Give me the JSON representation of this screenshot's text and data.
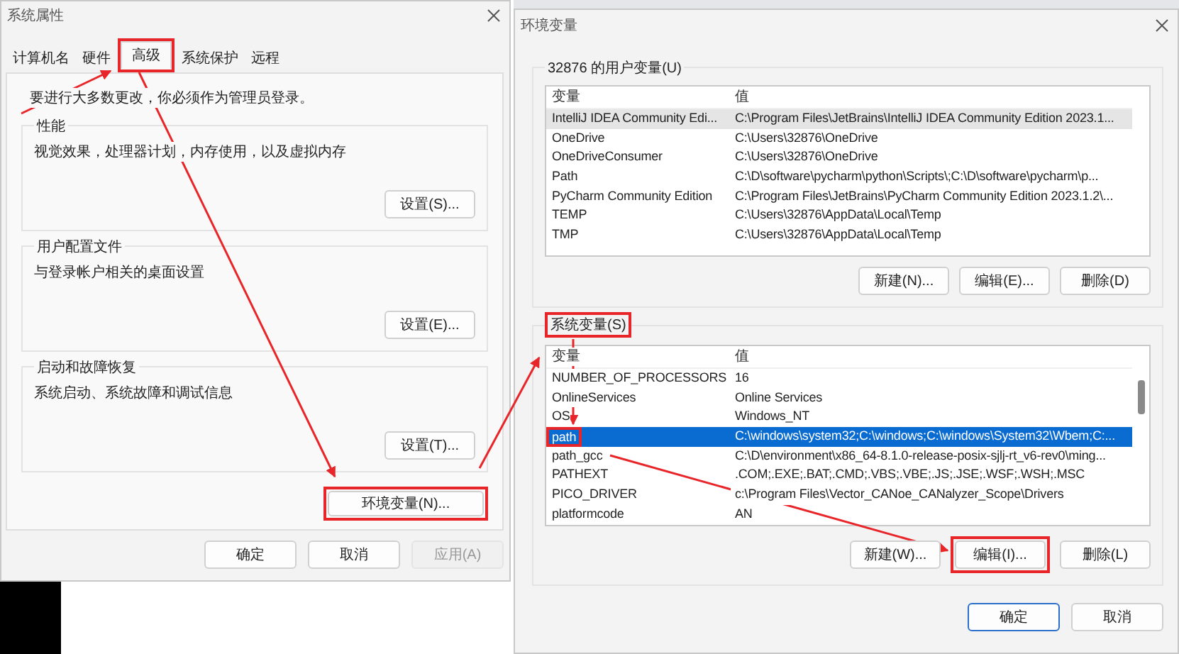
{
  "system_properties": {
    "title": "系统属性",
    "tabs": [
      {
        "label": "计算机名",
        "selected": false,
        "annotated": false
      },
      {
        "label": "硬件",
        "selected": false,
        "annotated": false
      },
      {
        "label": "高级",
        "selected": true,
        "annotated": true
      },
      {
        "label": "系统保护",
        "selected": false,
        "annotated": false
      },
      {
        "label": "远程",
        "selected": false,
        "annotated": false
      }
    ],
    "notice": "要进行大多数更改，你必须作为管理员登录。",
    "groups": [
      {
        "title": "性能",
        "description": "视觉效果，处理器计划，内存使用，以及虚拟内存",
        "button": "设置(S)..."
      },
      {
        "title": "用户配置文件",
        "description": "与登录帐户相关的桌面设置",
        "button": "设置(E)..."
      },
      {
        "title": "启动和故障恢复",
        "description": "系统启动、系统故障和调试信息",
        "button": "设置(T)..."
      }
    ],
    "env_button": {
      "label": "环境变量(N)...",
      "annotated": true
    },
    "buttons": [
      {
        "label": "确定",
        "disabled": false
      },
      {
        "label": "取消",
        "disabled": false
      },
      {
        "label": "应用(A)",
        "disabled": true
      }
    ]
  },
  "environment_variables": {
    "title": "环境变量",
    "lists": [
      {
        "title": "32876 的用户变量(U)",
        "title_annotated": false,
        "focused": false,
        "columns": [
          "变量",
          "值"
        ],
        "rows": [
          {
            "name": "IntelliJ IDEA Community Edi...",
            "value": "C:\\Program Files\\JetBrains\\IntelliJ IDEA Community Edition 2023.1...",
            "selected": true,
            "annotated": false
          },
          {
            "name": "OneDrive",
            "value": "C:\\Users\\32876\\OneDrive",
            "selected": false,
            "annotated": false
          },
          {
            "name": "OneDriveConsumer",
            "value": "C:\\Users\\32876\\OneDrive",
            "selected": false,
            "annotated": false
          },
          {
            "name": "Path",
            "value": "C:\\D\\software\\pycharm\\python\\Scripts\\;C:\\D\\software\\pycharm\\p...",
            "selected": false,
            "annotated": false
          },
          {
            "name": "PyCharm Community Edition",
            "value": "C:\\Program Files\\JetBrains\\PyCharm Community Edition 2023.1.2\\...",
            "selected": false,
            "annotated": false
          },
          {
            "name": "TEMP",
            "value": "C:\\Users\\32876\\AppData\\Local\\Temp",
            "selected": false,
            "annotated": false
          },
          {
            "name": "TMP",
            "value": "C:\\Users\\32876\\AppData\\Local\\Temp",
            "selected": false,
            "annotated": false
          }
        ],
        "buttons": [
          {
            "label": "新建(N)...",
            "annotated": false
          },
          {
            "label": "编辑(E)...",
            "annotated": false
          },
          {
            "label": "删除(D)",
            "annotated": false
          }
        ]
      },
      {
        "title": "系统变量(S)",
        "title_annotated": true,
        "focused": true,
        "columns": [
          "变量",
          "值"
        ],
        "rows": [
          {
            "name": "NUMBER_OF_PROCESSORS",
            "value": "16",
            "selected": false,
            "annotated": false
          },
          {
            "name": "OnlineServices",
            "value": "Online Services",
            "selected": false,
            "annotated": false
          },
          {
            "name": "OS",
            "value": "Windows_NT",
            "selected": false,
            "annotated": false
          },
          {
            "name": "path",
            "value": "C:\\windows\\system32;C:\\windows;C:\\windows\\System32\\Wbem;C:...",
            "selected": true,
            "annotated": true
          },
          {
            "name": "path_gcc",
            "value": "C:\\D\\environment\\x86_64-8.1.0-release-posix-sjlj-rt_v6-rev0\\ming...",
            "selected": false,
            "annotated": false
          },
          {
            "name": "PATHEXT",
            "value": ".COM;.EXE;.BAT;.CMD;.VBS;.VBE;.JS;.JSE;.WSF;.WSH;.MSC",
            "selected": false,
            "annotated": false
          },
          {
            "name": "PICO_DRIVER",
            "value": "c:\\Program Files\\Vector_CANoe_CANalyzer_Scope\\Drivers",
            "selected": false,
            "annotated": false
          },
          {
            "name": "platformcode",
            "value": "AN",
            "selected": false,
            "annotated": false
          }
        ],
        "buttons": [
          {
            "label": "新建(W)...",
            "annotated": false
          },
          {
            "label": "编辑(I)...",
            "annotated": true
          },
          {
            "label": "删除(L)",
            "annotated": false
          }
        ]
      }
    ],
    "buttons": [
      {
        "label": "确定",
        "default": true
      },
      {
        "label": "取消",
        "default": false
      }
    ]
  }
}
